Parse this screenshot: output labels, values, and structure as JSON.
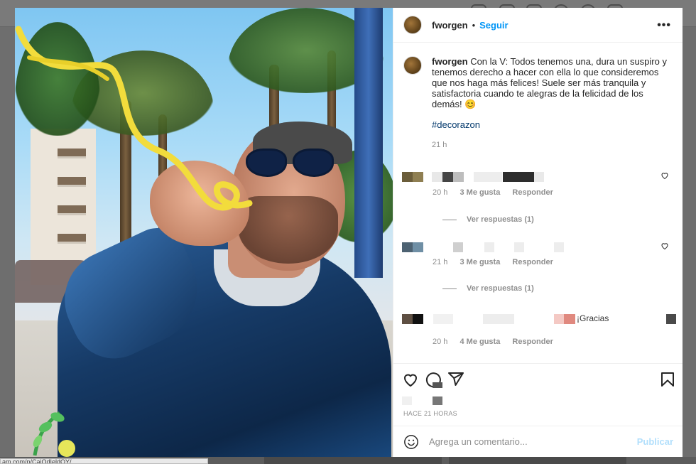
{
  "status_bar": {
    "url": "am.com/p/CajOdIeldOY/"
  },
  "post": {
    "username": "fworgen",
    "separator": "•",
    "follow_label": "Seguir",
    "more_label": "•••",
    "caption": {
      "username": "fworgen",
      "text": "Con la V: Todos tenemos una, dura un suspiro y tenemos derecho a hacer con ella lo que consideremos que nos haga más felices! Suele ser más tranquila y satisfactoria cuando te alegras de la felicidad de los demás! 😊",
      "hashtag": "#decorazon",
      "time": "21 h"
    },
    "comments": [
      {
        "time": "20 h",
        "likes": "3 Me gusta",
        "reply_label": "Responder",
        "replies_label": "Ver respuestas (1)"
      },
      {
        "time": "21 h",
        "likes": "3 Me gusta",
        "reply_label": "Responder",
        "replies_label": "Ver respuestas (1)"
      },
      {
        "time": "20 h",
        "likes": "4 Me gusta",
        "reply_label": "Responder",
        "text_fragment": "¡Gracias"
      }
    ],
    "posted_label": "HACE 21 HORAS",
    "add_comment": {
      "placeholder": "Agrega un comentario...",
      "publish_label": "Publicar"
    }
  },
  "icons": [
    "heart-icon",
    "comment-icon",
    "share-icon",
    "bookmark-icon",
    "emoji-icon",
    "more-icon",
    "like-heart-icon"
  ],
  "colors": {
    "link_blue": "#0095f6",
    "publish_disabled": "#b2dffc",
    "muted_text": "#8e8e8e",
    "hashtag": "#00376b"
  }
}
